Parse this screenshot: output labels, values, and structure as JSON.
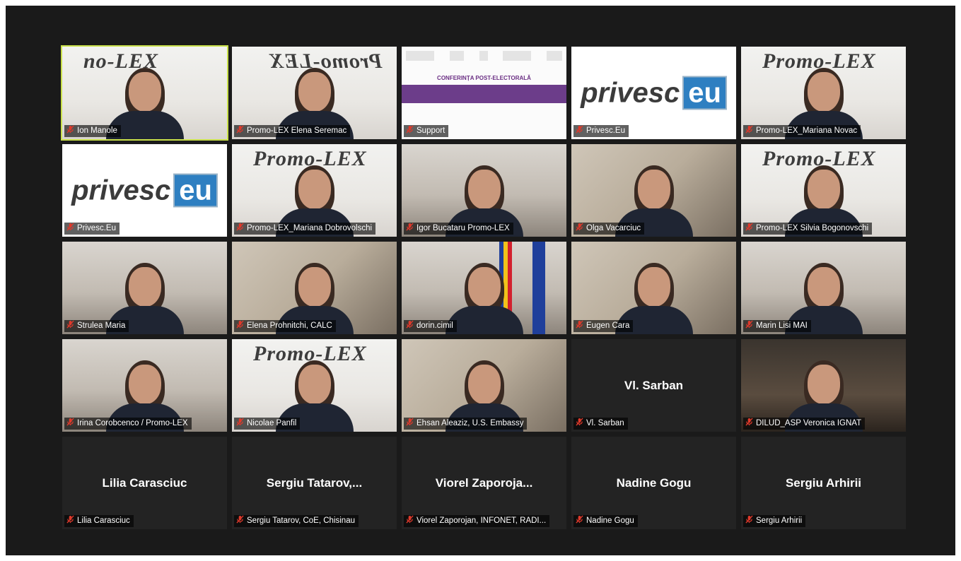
{
  "meeting": {
    "tiles": [
      {
        "name": "Ion Manole",
        "active": true,
        "bg": "promo",
        "logo": "no-LEX",
        "logo_flip": false
      },
      {
        "name": "Promo-LEX Elena Seremac",
        "bg": "promo",
        "logo": "Promo-LEX",
        "logo_flip": true
      },
      {
        "name": "Support",
        "bg": "slide",
        "slide_title": "CONFERINȚA POST-ELECTORALĂ"
      },
      {
        "name": "Privesc.Eu",
        "bg": "privesc"
      },
      {
        "name": "Promo-LEX_Mariana Novac",
        "bg": "promo",
        "logo": "Promo-LEX",
        "logo_flip": false
      },
      {
        "name": "Privesc.Eu",
        "bg": "privesc"
      },
      {
        "name": "Promo-LEX_Mariana Dobrovolschi",
        "bg": "promo",
        "logo": "Promo-LEX",
        "logo_flip": false
      },
      {
        "name": "Igor Bucataru Promo-LEX",
        "bg": "room"
      },
      {
        "name": "Olga Vacarciuc",
        "bg": "office"
      },
      {
        "name": "Promo-LEX Silvia Bogonovschi",
        "bg": "promo",
        "logo": "Promo-LEX",
        "logo_flip": false
      },
      {
        "name": "Strulea Maria",
        "bg": "room"
      },
      {
        "name": "Elena Prohnitchi, CALC",
        "bg": "office"
      },
      {
        "name": "dorin.cimil",
        "bg": "room",
        "flags": true
      },
      {
        "name": "Eugen Cara",
        "bg": "office"
      },
      {
        "name": "Marin Lisi MAI",
        "bg": "room"
      },
      {
        "name": "Irina Corobcenco / Promo-LEX",
        "bg": "room"
      },
      {
        "name": "Nicolae Panfil",
        "bg": "promo",
        "logo": "Promo-LEX",
        "logo_flip": false
      },
      {
        "name": "Ehsan Aleaziz, U.S. Embassy",
        "bg": "office"
      },
      {
        "name": "Vl. Sarban",
        "bg": "none",
        "display_name": "Vl. Sarban"
      },
      {
        "name": "DILUD_ASP Veronica IGNAT",
        "bg": "dark"
      },
      {
        "name": "Lilia Carasciuc",
        "bg": "none",
        "display_name": "Lilia Carasciuc"
      },
      {
        "name": "Sergiu Tatarov, CoE, Chisinau",
        "bg": "none",
        "display_name": "Sergiu Tatarov,..."
      },
      {
        "name": "Viorel Zaporojan, INFONET, RADI...",
        "bg": "none",
        "display_name": "Viorel Zaporoja..."
      },
      {
        "name": "Nadine Gogu",
        "bg": "none",
        "display_name": "Nadine Gogu"
      },
      {
        "name": "Sergiu Arhirii",
        "bg": "none",
        "display_name": "Sergiu Arhirii"
      }
    ]
  },
  "colors": {
    "active_border": "#c9e04a",
    "mic_muted": "#e0392b",
    "tile_bg": "#232323",
    "window_bg": "#1a1a1a"
  },
  "icons": {
    "muted": "microphone-muted-icon"
  }
}
